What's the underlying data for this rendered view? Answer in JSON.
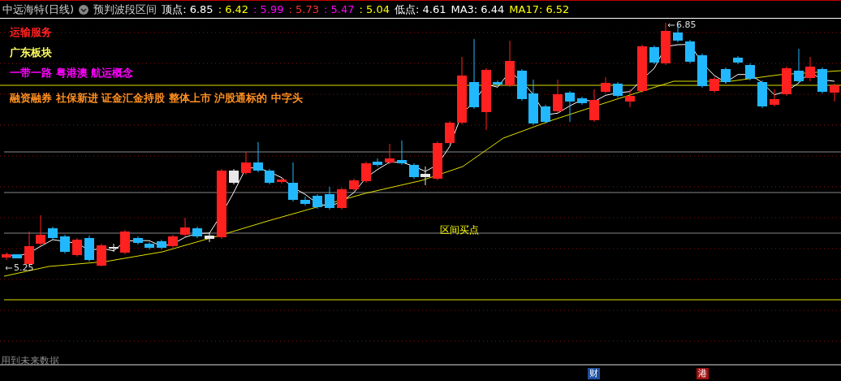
{
  "header": {
    "title": "中远海特(日线)",
    "indicator": "预判波段区间",
    "values": [
      {
        "text": "顶点: 6.85",
        "color": "#ffffff"
      },
      {
        "text": ": 6.42",
        "color": "#ffff00"
      },
      {
        "text": ": 5.99",
        "color": "#ff00ff"
      },
      {
        "text": ": 5.73",
        "color": "#ff3030"
      },
      {
        "text": ": 5.47",
        "color": "#ff00ff"
      },
      {
        "text": ": 5.04",
        "color": "#ffff00"
      },
      {
        "text": "低点: 4.61",
        "color": "#ffffff"
      },
      {
        "text": "MA3: 6.44",
        "color": "#ffffff"
      },
      {
        "text": "MA17: 6.52",
        "color": "#ffff00"
      }
    ]
  },
  "chart": {
    "tags": [
      {
        "text": "运输服务",
        "color": "#ff2020"
      },
      {
        "text": "广东板块",
        "color": "#ffff60"
      },
      {
        "text": "一带一路 粤港澳 航运概念",
        "color": "#ff00ff"
      },
      {
        "text": "融资融券 社保新进 证金汇金持股 整体上市 沪股通标的 中字头",
        "color": "#ff9020"
      }
    ],
    "high_label": "6.85",
    "low_label": "5.25",
    "signal_label": "区间买点",
    "warning": "用到未来数据",
    "markers": [
      {
        "text": "财",
        "color": "#1e4fa0"
      },
      {
        "text": "港",
        "color": "#a01010"
      }
    ]
  }
}
